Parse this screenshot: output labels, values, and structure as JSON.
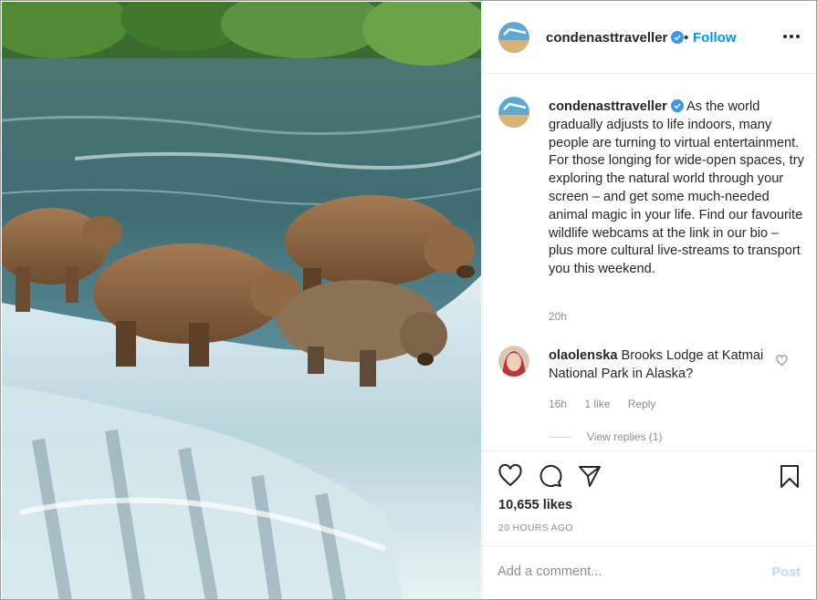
{
  "colors": {
    "link_blue": "#0095f6",
    "post_disabled": "#b2dffc",
    "muted_text": "#8e8e8e",
    "text": "#262626",
    "verified_badge": "#3897f0"
  },
  "header": {
    "username": "condenasttraveller",
    "separator": "•",
    "follow_label": "Follow",
    "more_icon": "more-horizontal-icon"
  },
  "caption": {
    "username": "condenasttraveller",
    "text": "As the world gradually adjusts to life indoors, many people are turning to virtual entertainment. For those longing for wide-open spaces, try exploring the natural world through your screen – and get some much-needed animal magic in your life. Find our favourite wildlife webcams at the link in our bio – plus more cultural live-streams to transport you this weekend.",
    "time": "20h"
  },
  "comment": {
    "username": "olaolenska",
    "text": "Brooks Lodge at Katmai National Park in Alaska?",
    "time": "16h",
    "likes": "1 like",
    "reply_label": "Reply",
    "view_replies": "View replies (1)"
  },
  "actions": {
    "like_icon": "heart-icon",
    "comment_icon": "comment-icon",
    "share_icon": "paper-plane-icon",
    "save_icon": "bookmark-icon",
    "likes_count": "10,655 likes",
    "time_ago": "20 HOURS AGO"
  },
  "add_comment": {
    "placeholder": "Add a comment...",
    "post_label": "Post"
  }
}
